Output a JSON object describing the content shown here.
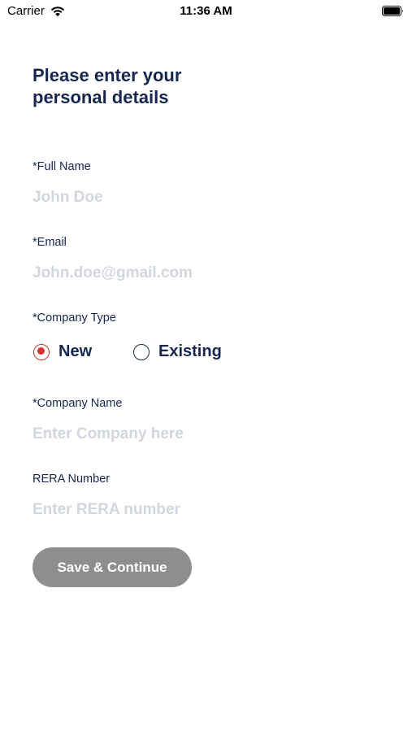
{
  "status_bar": {
    "carrier": "Carrier",
    "time": "11:36 AM",
    "icons": [
      "wifi-icon",
      "battery-icon"
    ]
  },
  "title": "Please enter your personal details",
  "form": {
    "full_name": {
      "label": "*Full Name",
      "value": "",
      "placeholder": "John Doe"
    },
    "email": {
      "label": "*Email",
      "value": "",
      "placeholder": "John.doe@gmail.com"
    },
    "company_type": {
      "label": "*Company Type",
      "options": [
        {
          "label": "New",
          "selected": true
        },
        {
          "label": "Existing",
          "selected": false
        }
      ]
    },
    "company_name": {
      "label": "*Company Name",
      "value": "",
      "placeholder": "Enter Company here"
    },
    "rera_number": {
      "label": "RERA Number",
      "value": "",
      "placeholder": "Enter RERA number"
    }
  },
  "save_button_label": "Save & Continue",
  "colors": {
    "text_primary": "#17264f",
    "placeholder": "#d2d6df",
    "radio_selected": "#d8322f",
    "button_bg": "#8e8e8e",
    "button_text": "#ffffff"
  }
}
